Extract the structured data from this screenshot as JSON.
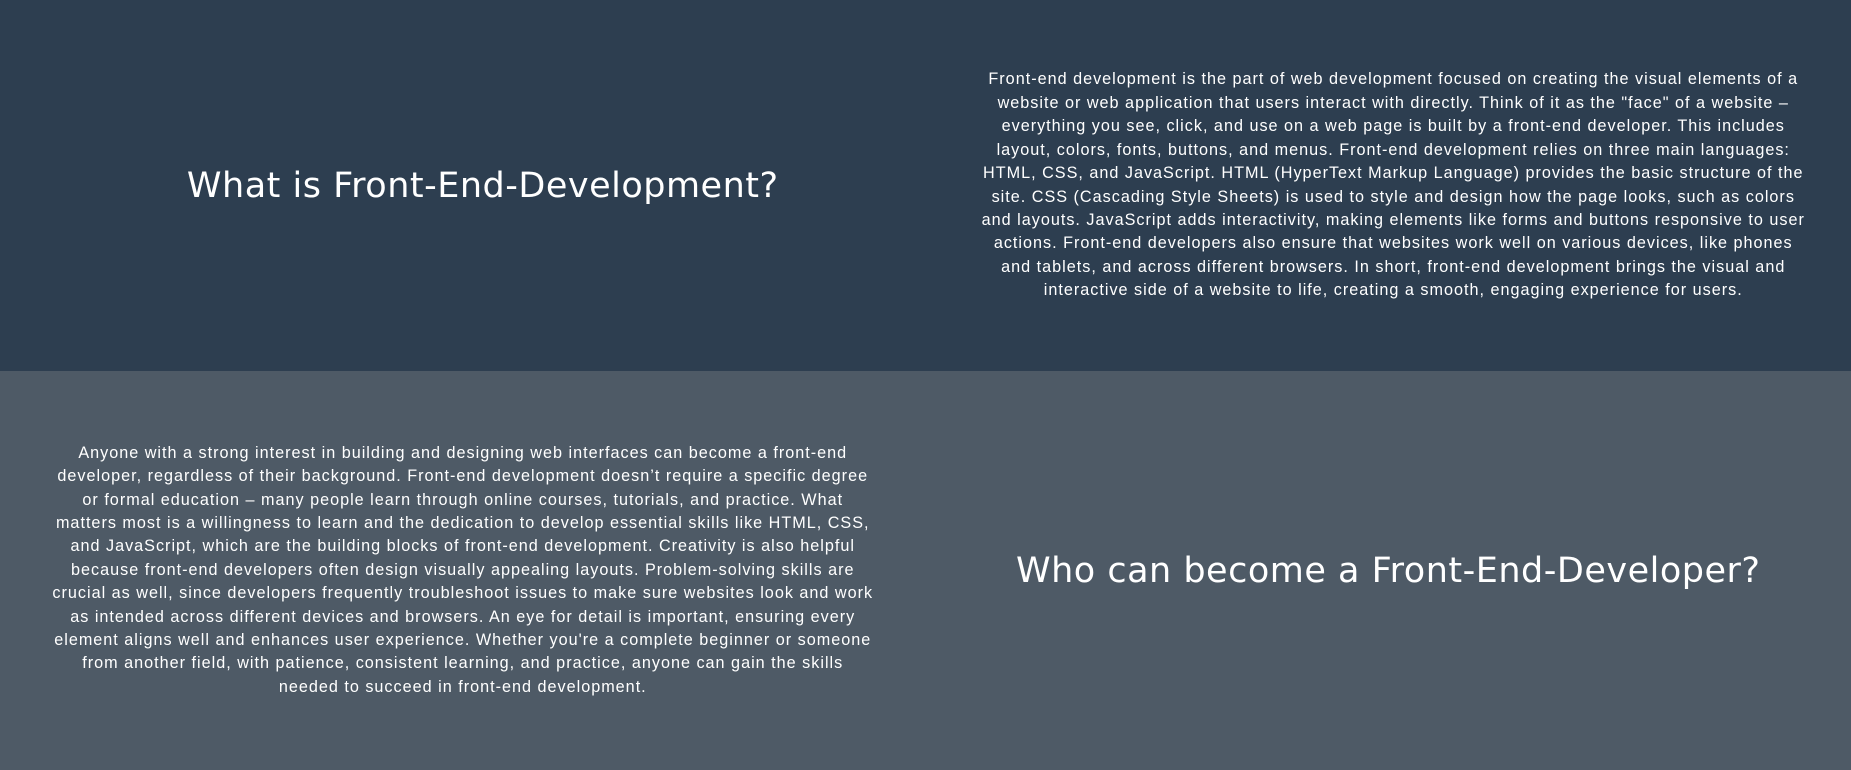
{
  "sections": [
    {
      "heading": "What is Front-End-Development?",
      "body": "Front-end development is the part of web development focused on creating the visual elements of a website or web application that users interact with directly. Think of it as the \"face\" of a website – everything you see, click, and use on a web page is built by a front-end developer. This includes layout, colors, fonts, buttons, and menus. Front-end development relies on three main languages: HTML, CSS, and JavaScript. HTML (HyperText Markup Language) provides the basic structure of the site. CSS (Cascading Style Sheets) is used to style and design how the page looks, such as colors and layouts. JavaScript adds interactivity, making elements like forms and buttons responsive to user actions. Front-end developers also ensure that websites work well on various devices, like phones and tablets, and across different browsers. In short, front-end development brings the visual and interactive side of a website to life, creating a smooth, engaging experience for users."
    },
    {
      "heading": "Who can become a Front-End-Developer?",
      "body": "Anyone with a strong interest in building and designing web interfaces can become a front-end developer, regardless of their background. Front-end development doesn’t require a specific degree or formal education – many people learn through online courses, tutorials, and practice. What matters most is a willingness to learn and the dedication to develop essential skills like HTML, CSS, and JavaScript, which are the building blocks of front-end development. Creativity is also helpful because front-end developers often design visually appealing layouts. Problem-solving skills are crucial as well, since developers frequently troubleshoot issues to make sure websites look and work as intended across different devices and browsers. An eye for detail is important, ensuring every element aligns well and enhances user experience. Whether you're a complete beginner or someone from another field, with patience, consistent learning, and practice, anyone can gain the skills needed to succeed in front-end development."
    }
  ],
  "colors": {
    "section_top_bg": "#2d3e50",
    "section_bottom_bg": "#4e5a66",
    "text": "#ffffff"
  }
}
